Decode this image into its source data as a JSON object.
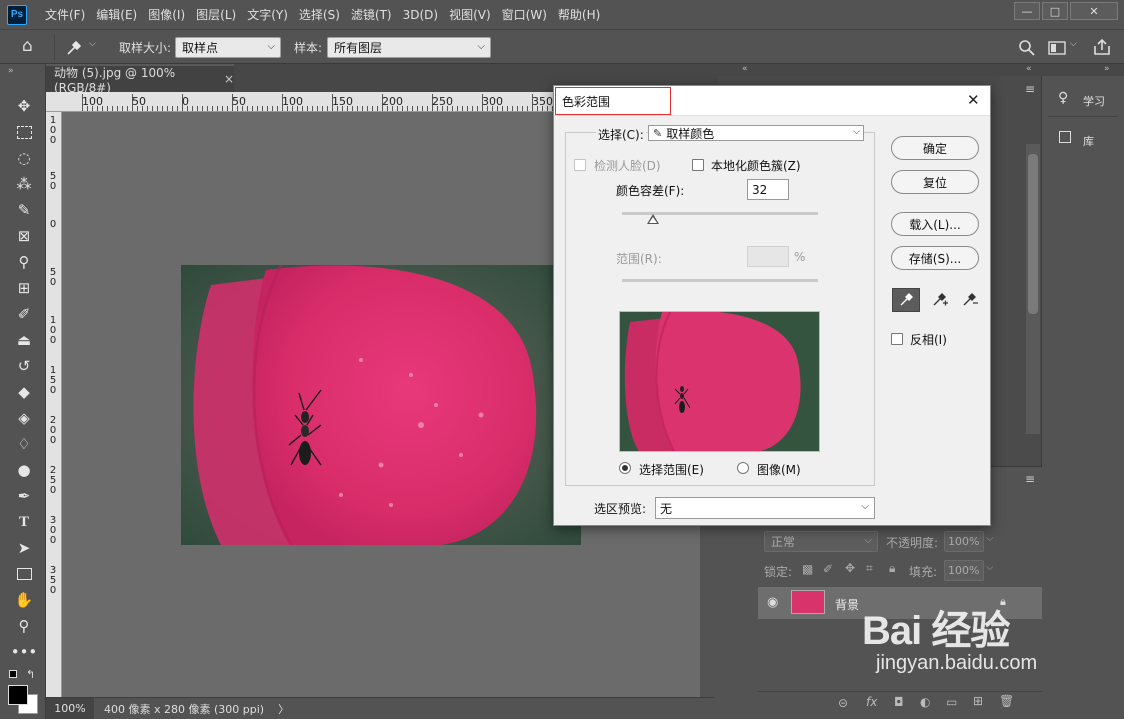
{
  "menubar": {
    "logo": "Ps",
    "items": [
      "文件(F)",
      "编辑(E)",
      "图像(I)",
      "图层(L)",
      "文字(Y)",
      "选择(S)",
      "滤镜(T)",
      "3D(D)",
      "视图(V)",
      "窗口(W)",
      "帮助(H)"
    ],
    "minimize": "—",
    "maximize": "□",
    "close": "✕"
  },
  "optbar": {
    "sample_size_label": "取样大小:",
    "sample_size_value": "取样点",
    "sample_label": "样本:",
    "sample_value": "所有图层"
  },
  "document": {
    "tab_title": "动物 (5).jpg @ 100%(RGB/8#)",
    "tab_close": "×",
    "zoom": "100%",
    "info": "400 像素 x 280 像素 (300 ppi)",
    "info_arrow": "〉"
  },
  "ruler": {
    "h_labels": [
      "100",
      "50",
      "0",
      "50",
      "100",
      "150",
      "200",
      "250",
      "300",
      "350"
    ],
    "v_labels": [
      "1\n0\n0",
      "5\n0",
      "0",
      "5\n0",
      "1\n0\n0",
      "1\n5\n0",
      "2\n0\n0",
      "2\n5\n0",
      "3\n0\n0",
      "3\n5\n0"
    ]
  },
  "right_panels": {
    "learn": "学习",
    "library": "库",
    "blend_mode": "正常",
    "opacity_label": "不透明度:",
    "opacity_value": "100%",
    "lock_label": "锁定:",
    "fill_label": "填充:",
    "fill_value": "100%",
    "layer_name": "背景"
  },
  "dialog": {
    "title": "色彩范围",
    "close": "✕",
    "select_label": "选择(C):",
    "select_value": "取样颜色",
    "detect_faces": "检测人脸(D)",
    "localized": "本地化颜色簇(Z)",
    "fuzziness_label": "颜色容差(F):",
    "fuzziness_value": "32",
    "fuzziness_level": 0.16,
    "range_label": "范围(R):",
    "range_unit": "%",
    "view_selection": "选择范围(E)",
    "view_image": "图像(M)",
    "preview_label": "选区预览:",
    "preview_value": "无",
    "ok": "确定",
    "reset": "复位",
    "load": "载入(L)...",
    "save": "存储(S)...",
    "invert": "反相(I)"
  },
  "watermark": {
    "text": "Bai 经验",
    "url": "jingyan.baidu.com"
  },
  "colors": {
    "ui_bg": "#535353",
    "canvas": "#6b6b6b",
    "dialog_bg": "#f0f0f0",
    "petal": "#e0346e",
    "highlight_box": "#e03030"
  }
}
